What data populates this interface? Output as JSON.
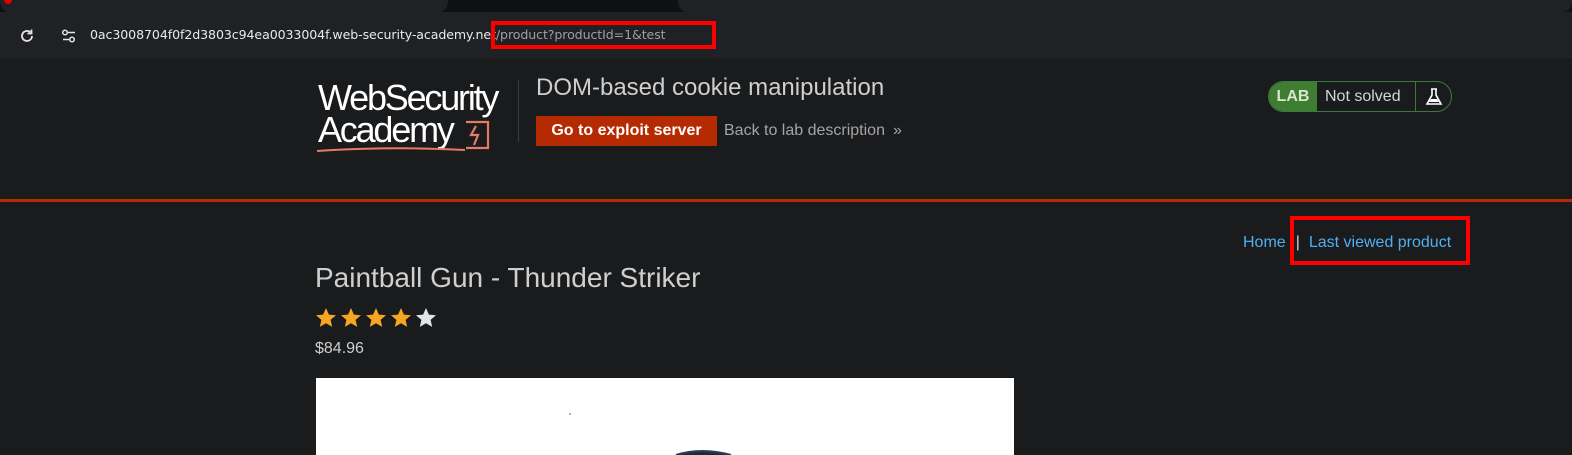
{
  "browser": {
    "url_host": "0ac3008704f0f2d3803c94ea0033004f.web-security-academy.n",
    "url_host_tail": "et",
    "url_path": "/product?productId=1&test",
    "reload_icon": "reload-icon",
    "site_info_icon": "tune-icon"
  },
  "header": {
    "logo_line1": "WebSecurity",
    "logo_line2": "Academy",
    "lab_title": "DOM-based cookie manipulation",
    "exploit_button_label": "Go to exploit server",
    "back_link_label": "Back to lab description",
    "back_link_chevron": "»",
    "lab_badge": {
      "label": "LAB",
      "status": "Not solved",
      "icon": "flask-icon"
    }
  },
  "nav": {
    "home_label": "Home",
    "separator": "|",
    "last_viewed_label": "Last viewed product"
  },
  "product": {
    "title": "Paintball Gun - Thunder Striker",
    "rating": 4,
    "rating_max": 5,
    "price": "$84.96"
  },
  "colors": {
    "brand_orange": "#b52a00",
    "link_blue": "#4fb0f0",
    "lab_green": "#3f7d32",
    "star_gold": "#f5a623",
    "star_empty": "#e0e4e8",
    "highlight_red": "#ff0000"
  }
}
